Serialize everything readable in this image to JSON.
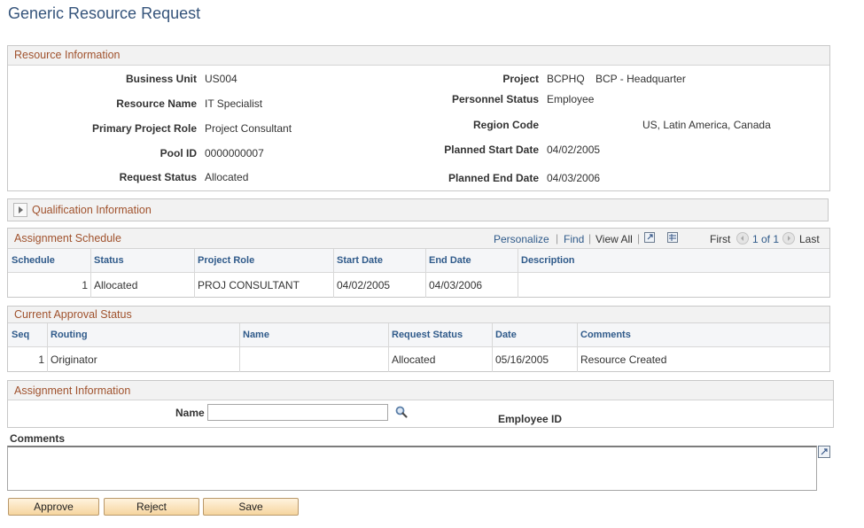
{
  "page": {
    "title": "Generic Resource Request"
  },
  "resource_info": {
    "section_title": "Resource Information",
    "business_unit": {
      "label": "Business Unit",
      "value": "US004"
    },
    "resource_name": {
      "label": "Resource Name",
      "value": "IT Specialist"
    },
    "primary_project_role": {
      "label": "Primary Project Role",
      "value": "Project Consultant"
    },
    "pool_id": {
      "label": "Pool ID",
      "value": "0000000007"
    },
    "request_status": {
      "label": "Request Status",
      "value": "Allocated"
    },
    "project": {
      "label": "Project",
      "value": "BCPHQ",
      "description": "BCP - Headquarter"
    },
    "personnel_status": {
      "label": "Personnel Status",
      "value": "Employee"
    },
    "region_code": {
      "label": "Region Code",
      "value": "US, Latin America, Canada"
    },
    "planned_start_date": {
      "label": "Planned Start Date",
      "value": "04/02/2005"
    },
    "planned_end_date": {
      "label": "Planned End Date",
      "value": "04/03/2006"
    }
  },
  "qualification": {
    "title": "Qualification Information"
  },
  "assignment_schedule": {
    "title": "Assignment Schedule",
    "nav": {
      "personalize": "Personalize",
      "find": "Find",
      "view_all": "View All",
      "first": "First",
      "range": "1 of 1",
      "last": "Last"
    },
    "columns": [
      "Schedule",
      "Status",
      "Project Role",
      "Start Date",
      "End Date",
      "Description"
    ],
    "rows": [
      {
        "schedule": "1",
        "status": "Allocated",
        "project_role": "PROJ CONSULTANT",
        "start_date": "04/02/2005",
        "end_date": "04/03/2006",
        "description": ""
      }
    ]
  },
  "approval_status": {
    "title": "Current Approval Status",
    "columns": [
      "Seq",
      "Routing",
      "Name",
      "Request Status",
      "Date",
      "Comments"
    ],
    "rows": [
      {
        "seq": "1",
        "routing": "Originator",
        "name": "",
        "request_status": "Allocated",
        "date": "05/16/2005",
        "comments": "Resource Created"
      }
    ]
  },
  "assignment_info": {
    "title": "Assignment Information",
    "name_label": "Name",
    "name_value": "",
    "employee_id_label": "Employee ID"
  },
  "comments": {
    "label": "Comments",
    "value": ""
  },
  "buttons": {
    "approve": "Approve",
    "reject": "Reject",
    "save": "Save"
  },
  "icons": {
    "expand": "expand-triangle-icon",
    "zoom": "zoom-grid-icon",
    "download": "download-grid-icon",
    "prev": "previous-row-icon",
    "next": "next-row-icon",
    "lookup": "lookup-magnifier-icon",
    "popup": "popup-editor-icon"
  },
  "colors": {
    "title": "#35547b",
    "section_title": "#a0522d",
    "link": "#2f5a8a",
    "button_border": "#b9986a"
  }
}
